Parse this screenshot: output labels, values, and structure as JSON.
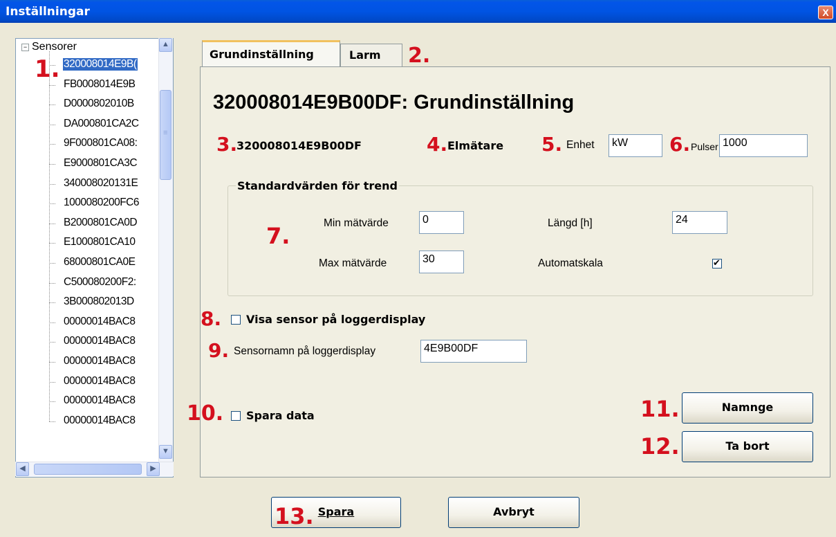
{
  "window": {
    "title": "Inställningar",
    "close_glyph": "X"
  },
  "tree": {
    "root_label": "Sensorer",
    "expander_glyph": "−",
    "selected_index": 0,
    "items": [
      "320008014E9B(",
      "FB0008014E9B",
      "D0000802010B",
      "DA000801CA2C",
      "9F000801CA08:",
      "E9000801CA3C",
      "340008020131E",
      "1000080200FC6",
      "B2000801CA0D",
      "E1000801CA10",
      "68000801CA0E",
      "C500080200F2:",
      "3B000802013D",
      "00000014BAC8",
      "00000014BAC8",
      "00000014BAC8",
      "00000014BAC8",
      "00000014BAC8",
      "00000014BAC8"
    ]
  },
  "tabs": [
    {
      "label": "Grundinställning",
      "active": true
    },
    {
      "label": "Larm",
      "active": false
    }
  ],
  "panel": {
    "heading": "320008014E9B00DF: Grundinställning",
    "sensor_id": "320008014E9B00DF",
    "sensor_type": "Elmätare",
    "unit_label": "Enhet",
    "unit_value": "kW",
    "pulses_label": "Pulser",
    "pulses_value": "1000",
    "trend_group_title": "Standardvärden för trend",
    "min_label": "Min mätvärde",
    "min_value": "0",
    "max_label": "Max mätvärde",
    "max_value": "30",
    "length_label": "Längd [h]",
    "length_value": "24",
    "autoscale_label": "Automatskala",
    "autoscale_checked": true,
    "show_on_logger_label": "Visa sensor på loggerdisplay",
    "show_on_logger_checked": false,
    "logger_name_label": "Sensornamn på loggerdisplay",
    "logger_name_value": "4E9B00DF",
    "save_data_label": "Spara data",
    "save_data_checked": false,
    "rename_button": "Namnge",
    "delete_button": "Ta bort"
  },
  "footer": {
    "save_button": "Spara",
    "cancel_button": "Avbryt"
  },
  "annotations": {
    "n1": "1.",
    "n2": "2.",
    "n3": "3.",
    "n4": "4.",
    "n5": "5.",
    "n6": "6.",
    "n7": "7.",
    "n8": "8.",
    "n9": "9.",
    "n10": "10.",
    "n11": "11.",
    "n12": "12.",
    "n13": "13.",
    "color": "#D4101E"
  },
  "colors": {
    "titlebar": "#0054E3",
    "selection": "#316AC5",
    "tab_highlight": "#F1C15F",
    "dialog_bg": "#ECE9D8"
  },
  "icons": {
    "scroll_up": "▲",
    "scroll_down": "▼",
    "scroll_left": "◀",
    "scroll_right": "▶",
    "thumb_grip": "≡"
  }
}
